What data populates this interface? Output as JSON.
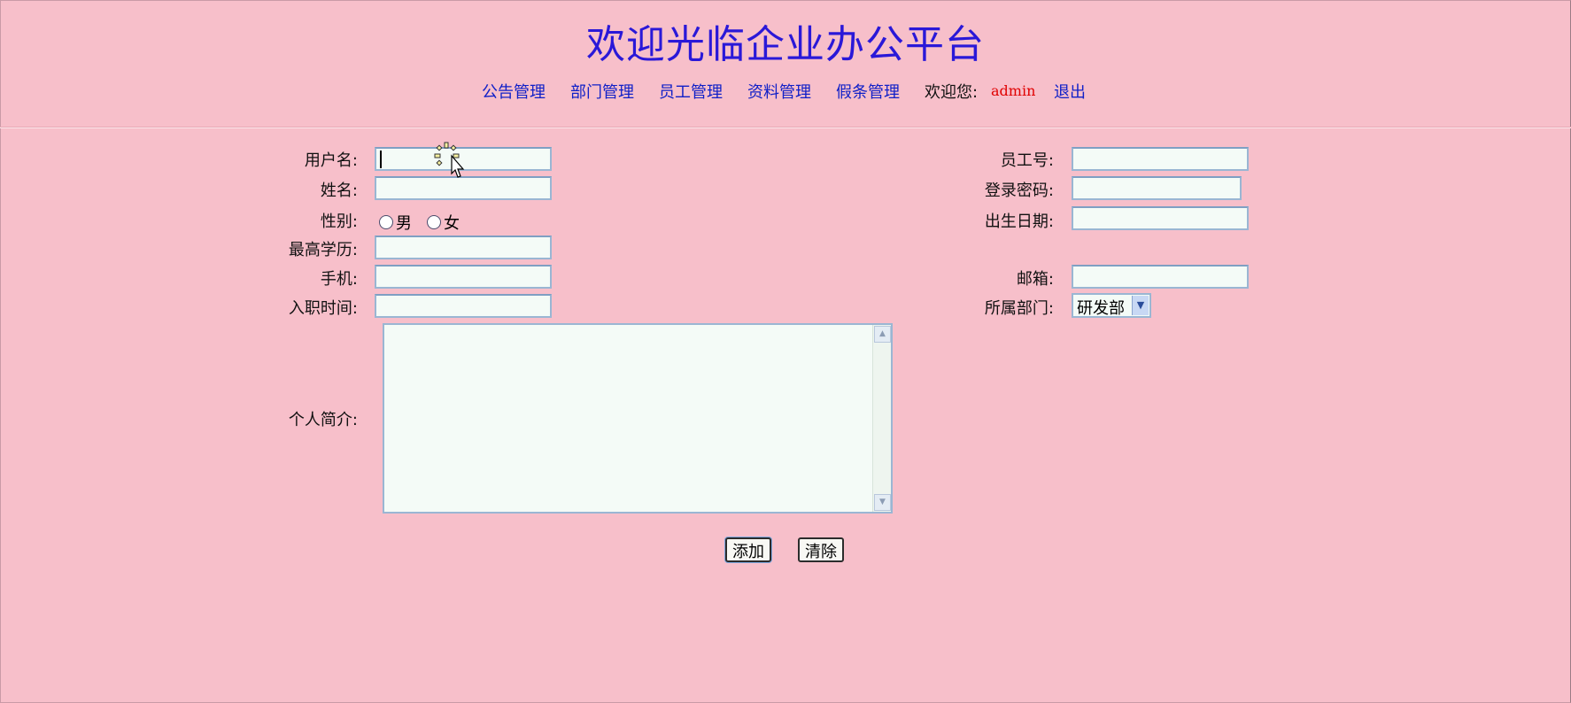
{
  "header": {
    "title": "欢迎光临企业办公平台"
  },
  "nav": {
    "items": [
      "公告管理",
      "部门管理",
      "员工管理",
      "资料管理",
      "假条管理"
    ],
    "welcome": "欢迎您:",
    "username": "admin",
    "logout": "退出"
  },
  "form": {
    "username_label": "用户名:",
    "name_label": "姓名:",
    "gender_label": "性别:",
    "gender_male": "男",
    "gender_female": "女",
    "education_label": "最高学历:",
    "phone_label": "手机:",
    "hire_date_label": "入职时间:",
    "bio_label": "个人简介:",
    "employee_no_label": "员工号:",
    "password_label": "登录密码:",
    "birthday_label": "出生日期:",
    "email_label": "邮箱:",
    "department_label": "所属部门:",
    "department_value": "研发部",
    "add_button": "添加",
    "clear_button": "清除"
  },
  "colors": {
    "background": "#f7bfca",
    "title": "#2a18d8",
    "link": "#1020c8",
    "username": "#e00000"
  }
}
